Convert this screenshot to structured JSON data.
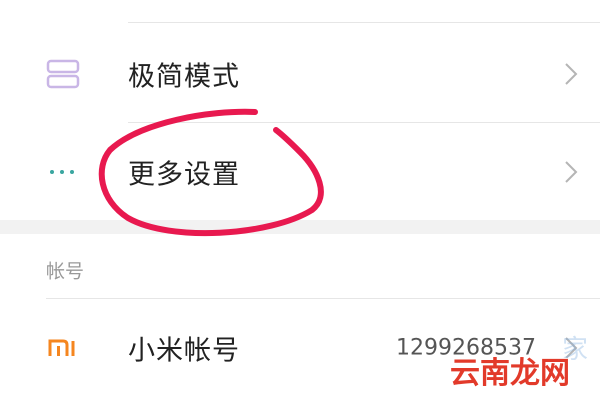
{
  "settings": {
    "rows": [
      {
        "label": "极简模式",
        "icon": "layout-blocks-icon"
      },
      {
        "label": "更多设置",
        "icon": "more-dots-icon"
      }
    ],
    "account_section": {
      "header": "帐号",
      "rows": [
        {
          "label": "小米帐号",
          "value": "1299268537",
          "icon": "mi-logo-icon"
        }
      ]
    }
  },
  "watermark": {
    "main": "云南龙网",
    "faint": "家"
  },
  "colors": {
    "annotation_stroke": "#e8194f",
    "icon_purple": "#c9b6e6",
    "icon_teal": "#3aa6a0",
    "mi_orange": "#f5861f",
    "watermark_red": "#e23a2a"
  }
}
